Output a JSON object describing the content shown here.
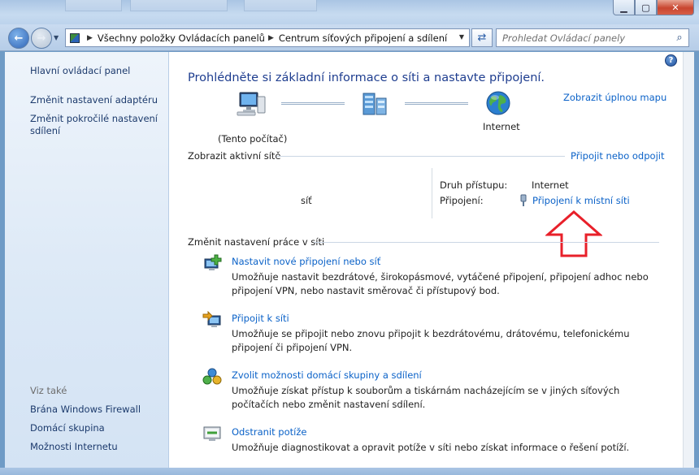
{
  "window": {
    "minimize_glyph": "▁",
    "maximize_glyph": "▢",
    "close_glyph": "✕"
  },
  "address": {
    "breadcrumbs": [
      "Všechny položky Ovládacích panelů",
      "Centrum síťových připojení a sdílení"
    ],
    "search_placeholder": "Prohledat Ovládací panely"
  },
  "sidebar": {
    "home": "Hlavní ovládací panel",
    "items": [
      "Změnit nastavení adaptéru",
      "Změnit pokročilé nastavení sdílení"
    ],
    "see_also_label": "Viz také",
    "see_also": [
      "Brána Windows Firewall",
      "Domácí skupina",
      "Možnosti Internetu"
    ]
  },
  "main": {
    "heading": "Prohlédněte si základní informace o síti a nastavte připojení.",
    "full_map": "Zobrazit úplnou mapu",
    "map": {
      "this_computer": "(Tento počítač)",
      "internet": "Internet"
    },
    "active_networks_title": "Zobrazit aktivní sítě",
    "connect_disconnect": "Připojit nebo odpojit",
    "network_name": "síť",
    "access_type_label": "Druh přístupu:",
    "access_type_value": "Internet",
    "connections_label": "Připojení:",
    "connections_value": "Připojení k místní síti",
    "change_settings_title": "Změnit nastavení práce v síti",
    "tasks": [
      {
        "title": "Nastavit nové připojení nebo síť",
        "desc": "Umožňuje nastavit bezdrátové, širokopásmové, vytáčené připojení, připojení adhoc nebo připojení VPN, nebo nastavit směrovač či přístupový bod."
      },
      {
        "title": "Připojit k síti",
        "desc": "Umožňuje se připojit nebo znovu připojit k bezdrátovému, drátovému, telefonickému připojení či připojení VPN."
      },
      {
        "title": "Zvolit možnosti domácí skupiny a sdílení",
        "desc": "Umožňuje získat přístup k souborům a tiskárnám nacházejícím se v jiných síťových počítačích nebo změnit nastavení sdílení."
      },
      {
        "title": "Odstranit potíže",
        "desc": "Umožňuje diagnostikovat a opravit potíže v síti nebo získat informace o řešení potíží."
      }
    ]
  },
  "colors": {
    "link": "#0b62c8",
    "heading": "#1e3d8f",
    "annotation_arrow": "#e8202a"
  }
}
